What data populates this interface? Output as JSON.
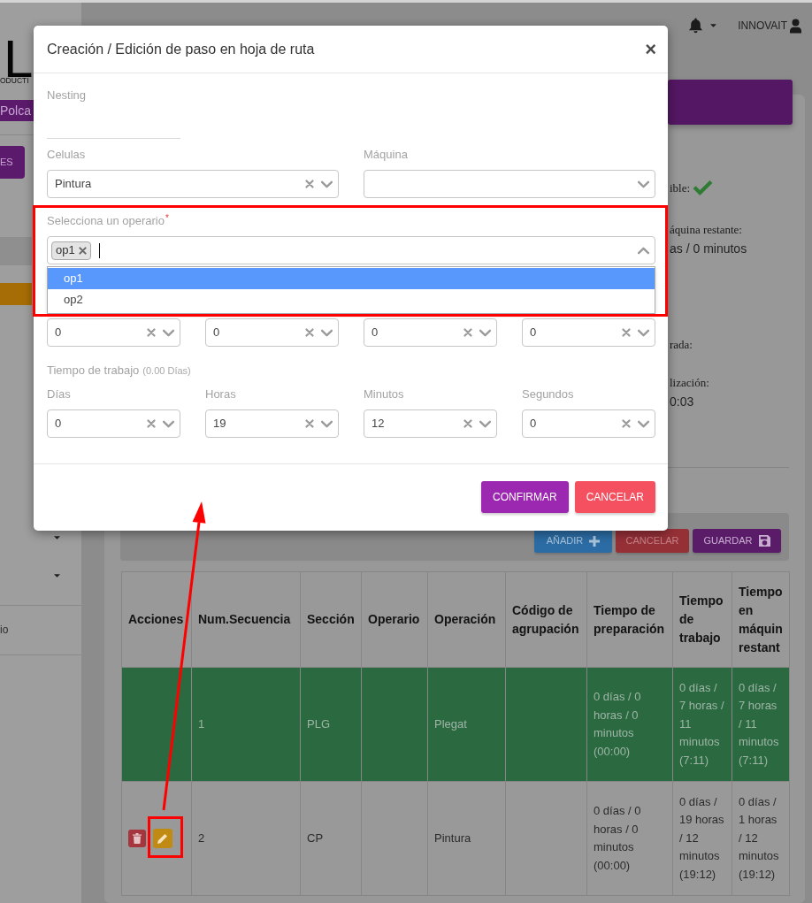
{
  "sidebar": {
    "logo": "L",
    "logo_subtitle": "ODUCTI",
    "app_tab": "Polca",
    "action_button": "ES",
    "menu": [
      {
        "kind": "shaded"
      },
      {
        "kind": "active"
      },
      {
        "kind": "dropdown"
      },
      {
        "kind": "dropdown"
      },
      {
        "kind": "link",
        "label": "io"
      }
    ]
  },
  "topbar": {
    "user": "INNOVAIT"
  },
  "card": {
    "status": [
      {
        "kind": "flag",
        "label": "ible:",
        "checked": true
      },
      {
        "kind": "text",
        "label": "áquina restante:",
        "value": "as / 0 minutos"
      },
      {
        "kind": "text",
        "label": "rada:"
      },
      {
        "kind": "text",
        "label": "lización:",
        "value": "0:03"
      }
    ],
    "toolbar": [
      {
        "kind": "add",
        "label": "AÑADIR"
      },
      {
        "kind": "cancel",
        "label": "CANCELAR"
      },
      {
        "kind": "save",
        "label": "GUARDAR"
      }
    ],
    "table": {
      "columns": [
        "Acciones",
        "Num.Secuencia",
        "Sección",
        "Operario",
        "Operación",
        "Código de agrupación",
        "Tiempo de preparación",
        "Tiempo de trabajo",
        "Tiempo en máquin restant"
      ],
      "rows": [
        {
          "highlighted": true,
          "cells": [
            "",
            "1",
            "PLG",
            "",
            "Plegat",
            "",
            "0 días / 0 horas / 0 minutos (00:00)",
            "0 días / 7 horas / 11 minutos (7:11)",
            "0 días / 7 horas / 11 minutos (7:11)"
          ]
        },
        {
          "highlighted": false,
          "actions": [
            {
              "kind": "delete"
            },
            {
              "kind": "edit",
              "annotated": true
            }
          ],
          "cells": [
            "",
            "2",
            "CP",
            "",
            "Pintura",
            "",
            "0 días / 0 horas / 0 minutos (00:00)",
            "0 días / 19 horas / 12 minutos (19:12)",
            "0 días / 1 horas / 12 minutos (19:12)"
          ]
        }
      ]
    }
  },
  "modal": {
    "title": "Creación / Edición de paso en hoja de ruta",
    "close": "×",
    "nesting": {
      "label": "Nesting"
    },
    "selects": [
      {
        "label": "Celulas",
        "value": "Pintura",
        "clearable": true
      },
      {
        "label": "Máquina",
        "clearable": false
      }
    ],
    "operator": {
      "label": "Selecciona un operario",
      "required_mark": "*",
      "tags": [
        "op1"
      ],
      "open": true,
      "annotated": true,
      "options": [
        {
          "label": "op1",
          "selected": true
        },
        {
          "label": "op2",
          "selected": false
        }
      ]
    },
    "preparation": [
      {
        "value": "0",
        "clearable": true
      },
      {
        "value": "0",
        "clearable": true
      },
      {
        "value": "0",
        "clearable": true
      },
      {
        "value": "0",
        "clearable": true
      }
    ],
    "work_time": {
      "label": "Tiempo de trabajo",
      "note": "(0.00 Días)",
      "fields": [
        {
          "label": "Días",
          "value": "0",
          "clearable": true
        },
        {
          "label": "Horas",
          "value": "19",
          "clearable": true
        },
        {
          "label": "Minutos",
          "value": "12",
          "clearable": true
        },
        {
          "label": "Segundos",
          "value": "0",
          "clearable": true
        }
      ]
    },
    "buttons": [
      {
        "kind": "confirm",
        "label": "CONFIRMAR"
      },
      {
        "kind": "cancel",
        "label": "CANCELAR"
      }
    ]
  },
  "annotation": {
    "kind": "arrow"
  }
}
